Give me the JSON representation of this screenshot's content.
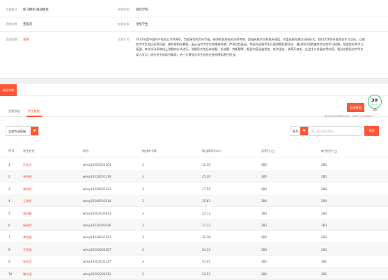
{
  "info": {
    "row1": {
      "label_a": "比赛模式",
      "value_a": "练习模式-挑战模式",
      "label_b": "参赛院校",
      "value_b": "湖北学院"
    },
    "row2": {
      "label_a": "答题次数",
      "value_a": "无限次",
      "label_b": "参赛对象",
      "value_b": "全校学生"
    },
    "row3": {
      "label_a": "奖励配置",
      "value_a": "查看",
      "label_b": "比赛介绍",
      "intro": "2021年是中国共产党成立100周年，为迎接党的百年华诞，继承和发扬党的光荣传统，加强高校学风和校风建设，丰富高校党建活动的形式，我们大学特开展党史学习活动，以激发大学生的历史责任感、使命感和自豪感，展示当代大学生的精神风貌，传承红色基因。特面向全校学生开展答题竞赛活动，通过知识竞赛激发学生的学习热情，营造良好的学习氛围。本次活动采取线上答题的方式进行，答题形式包括单选题、多选题、判断题等，题目内容涵盖党史、新中国史、改革开放史、社会主义发展史等内容，通过比赛促进大学生深入学习，提升学生的综合素质，进一步增强大学生的历史使命感和责任担当。"
    }
  },
  "data_section": {
    "tag": "湖北学院",
    "tabs": [
      "答题数据",
      "学生数据"
    ],
    "export_button": "导出数据",
    "export_note": "导出成功后请前往导出，不能人工如何解决。",
    "filter_select": "全部专业班级",
    "search_select": "账号",
    "search_placeholder": "输入账号进行搜索",
    "search_button": "搜索"
  },
  "table": {
    "headers": [
      "序号",
      "学生姓名",
      "账号",
      "挑战关卡数",
      "挑战用时(min)",
      "总积分",
      "综合总分"
    ],
    "rows": [
      {
        "idx": "1",
        "name": "石佳文",
        "account": "whey20201150103",
        "levels": "3",
        "time": "12.30",
        "score": "285",
        "total": "285"
      },
      {
        "idx": "2",
        "name": "张晓琴",
        "account": "whey19220201119",
        "levels": "3",
        "time": "25.20",
        "score": "285",
        "total": "285"
      },
      {
        "idx": "3",
        "name": "黄梓芯",
        "account": "whey19220201121",
        "levels": "3",
        "time": "17.55",
        "score": "284",
        "total": "284"
      },
      {
        "idx": "4",
        "name": "王晓琴",
        "account": "whey20200101014",
        "levels": "3",
        "time": "35.83",
        "score": "284",
        "total": "284"
      },
      {
        "idx": "5",
        "name": "胡雨晨",
        "account": "whey20202102813",
        "levels": "3",
        "time": "22.73",
        "score": "283",
        "total": "283"
      },
      {
        "idx": "6",
        "name": "杨晓玲",
        "account": "whey18220202026",
        "levels": "3",
        "time": "27.12",
        "score": "283",
        "total": "283"
      },
      {
        "idx": "7",
        "name": "李梓晴",
        "account": "whey18220101151",
        "levels": "3",
        "time": "32.38",
        "score": "283",
        "total": "283"
      },
      {
        "idx": "8",
        "name": "汪思琪",
        "account": "whey20202202207",
        "levels": "3",
        "time": "54.33",
        "score": "283",
        "total": "283"
      },
      {
        "idx": "9",
        "name": "张佳宜",
        "account": "whey19202102127",
        "levels": "3",
        "time": "57.47",
        "score": "282",
        "total": "282"
      },
      {
        "idx": "10",
        "name": "魏小丽",
        "account": "whey20202202012",
        "levels": "3",
        "time": "22.52",
        "score": "282",
        "total": "282"
      }
    ]
  },
  "badge": {
    "num": "30",
    "unit": "%",
    "sub": "0.6%↑"
  },
  "colors": {
    "accent": "#ff5733",
    "link": "#ff4d3a",
    "badge_ring": "#3ec46d"
  }
}
